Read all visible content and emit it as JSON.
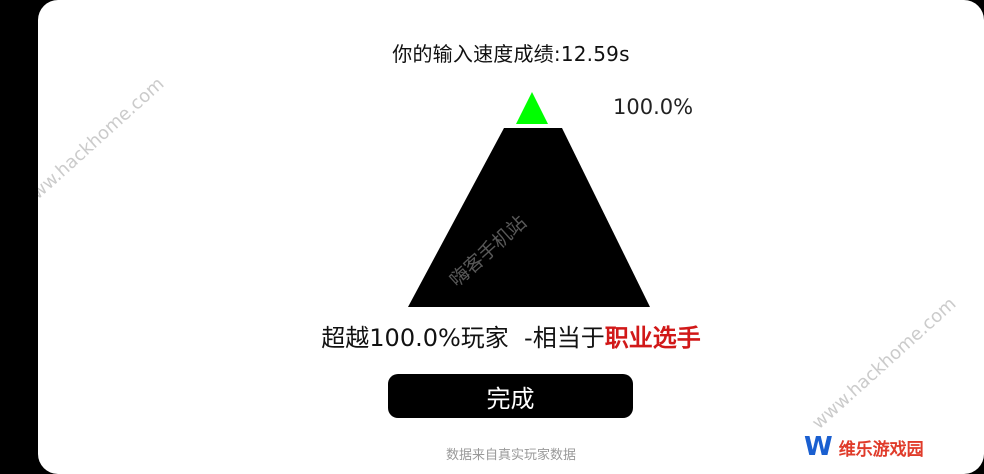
{
  "header": {
    "speed_label": "你的输入速度成绩:",
    "speed_value": "12.59s"
  },
  "pyramid": {
    "percent_label": "100.0%",
    "fill_fraction": 1.0,
    "top_color": "#00ff00",
    "body_color": "#000000"
  },
  "result": {
    "prefix": "超越",
    "percent": "100.0%",
    "middle": "玩家  -相当于",
    "rank": "职业选手",
    "rank_color": "#d11818"
  },
  "actions": {
    "done_label": "完成"
  },
  "footer": {
    "source": "数据来自真实玩家数据"
  },
  "watermarks": {
    "url_left": "www.hackhome.com",
    "cn_center": "嗨客手机站",
    "url_right": "www.hackhome.com"
  },
  "logo": {
    "mark": "W",
    "text": "维乐游戏园"
  }
}
